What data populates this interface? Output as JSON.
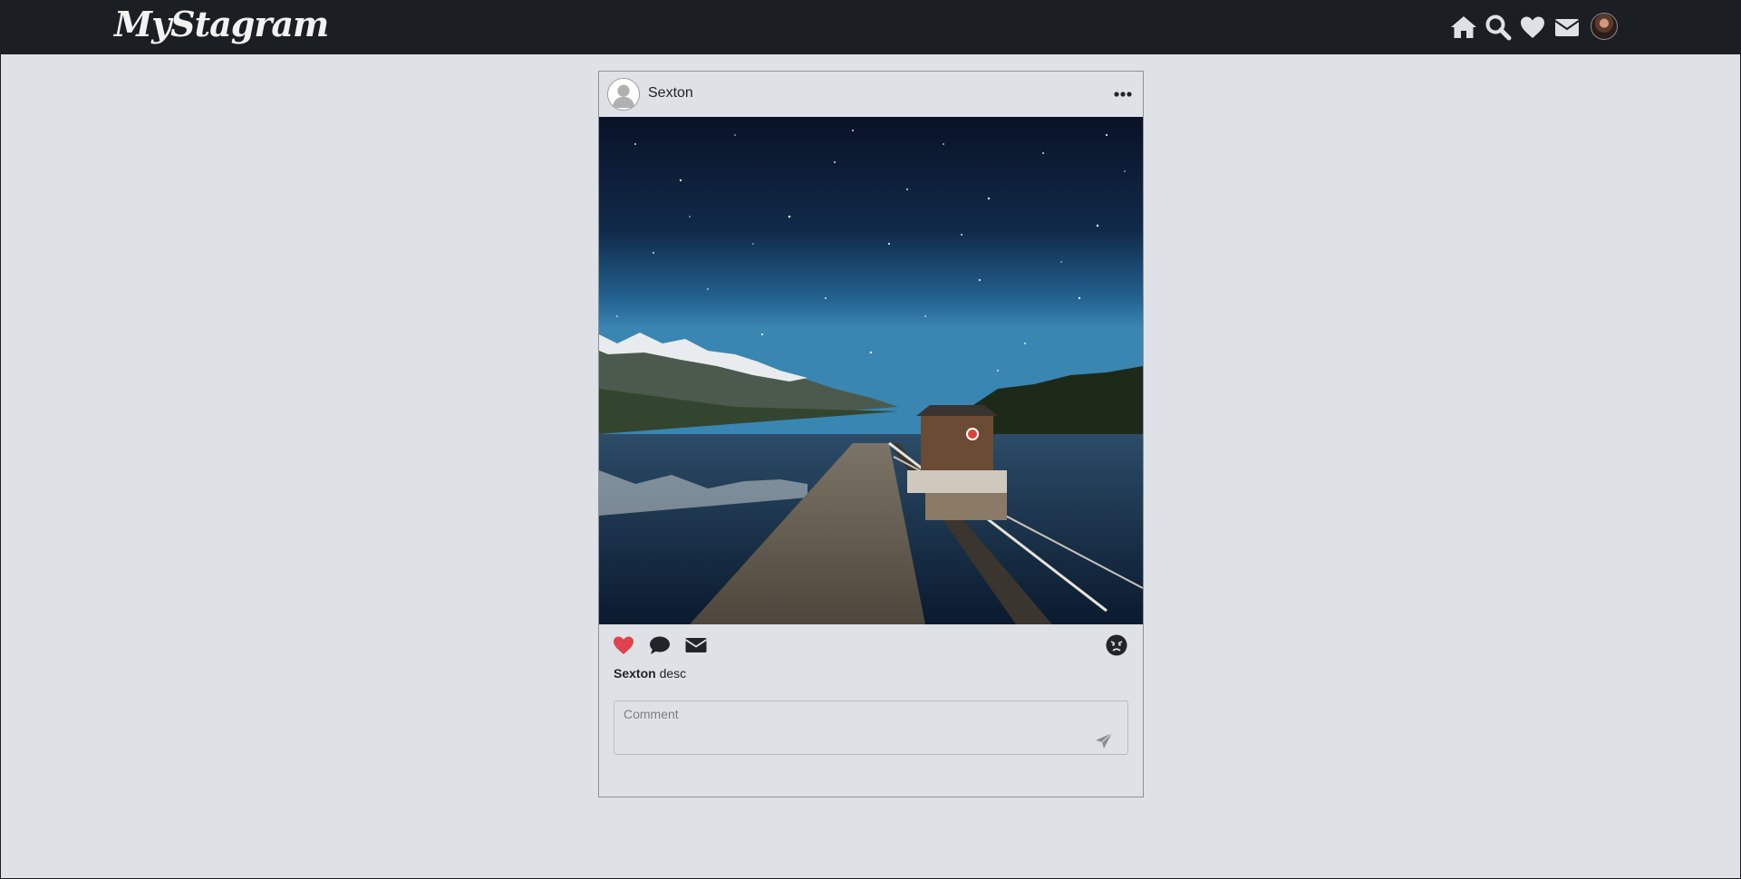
{
  "app": {
    "logo_text": "MyStagram"
  },
  "nav": {
    "icons": [
      "home-icon",
      "search-icon",
      "heart-icon",
      "envelope-icon"
    ],
    "avatar": "profile-avatar"
  },
  "post": {
    "author": "Sexton",
    "more_icon": "ellipsis-icon",
    "image_description": "night-sky-lake-pier-photo",
    "actions": {
      "like_icon": "heart-icon",
      "comment_icon": "speech-bubble-icon",
      "share_icon": "envelope-icon",
      "reaction_icon": "angry-face-icon"
    },
    "liked": true,
    "caption": {
      "username": "Sexton",
      "text": "desc"
    },
    "comment": {
      "placeholder": "Comment",
      "value": ""
    },
    "send_icon": "paper-plane-icon"
  },
  "colors": {
    "navbar": "#1b1f23",
    "background": "#dee2e6",
    "like_active": "#dc3545",
    "icon_dark": "#212529",
    "nav_icon": "#dee2e6"
  }
}
